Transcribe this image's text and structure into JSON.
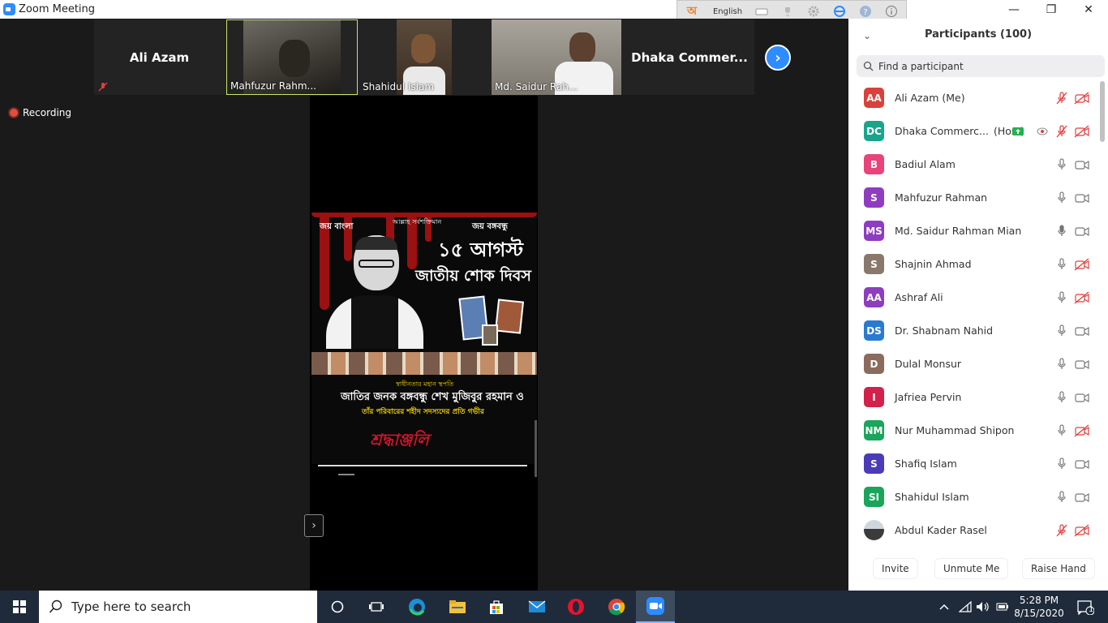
{
  "window": {
    "title": "Zoom Meeting",
    "min_label": "—",
    "max_label": "❐",
    "close_label": "✕"
  },
  "ime": {
    "language": "English",
    "glyph": "অ"
  },
  "thumbnails": [
    {
      "name": "Ali Azam",
      "kind": "name-only",
      "muted": true
    },
    {
      "name": "Mahfuzur Rahm...",
      "kind": "video",
      "muted": false
    },
    {
      "name": "Shahidul Islam",
      "kind": "video",
      "muted": false
    },
    {
      "name": "Md. Saidur Rah...",
      "kind": "video",
      "muted": true
    },
    {
      "name": "Dhaka  Commer...",
      "kind": "name-only",
      "muted": false
    }
  ],
  "next_arrow": "›",
  "recording": {
    "label": "Recording"
  },
  "poster": {
    "top_left": "জয় বাংলা",
    "top_center": "আল্লাহ সর্বশক্তিমান",
    "top_right": "জয় বঙ্গবন্ধু",
    "date": "১৫ আগস্ট",
    "headline": "জাতীয় শোক দিবস",
    "sub1": "স্বাধীনতার মহান স্থপতি",
    "sub2": "জাতির জনক বঙ্গবন্ধু শেখ মুজিবুর রহমান ও",
    "sub3": "তাঁর পরিবারের শহীদ সদস্যদের প্রতি গভীর",
    "sign": "শ্রদ্ধাঞ্জলি"
  },
  "panel": {
    "title": "Participants (100)",
    "search_placeholder": "Find a participant",
    "participants": [
      {
        "initials": "AA",
        "color": "#d9413a",
        "name": "Ali Azam (Me)",
        "host": "",
        "mic": "muted",
        "cam": "off"
      },
      {
        "initials": "DC",
        "color": "#1aa58b",
        "name": "Dhaka Commerc...",
        "host": "(Host)",
        "mic": "muted",
        "cam": "off"
      },
      {
        "initials": "B",
        "color": "#e8437a",
        "name": "Badiul Alam",
        "host": "",
        "mic": "on",
        "cam": "on"
      },
      {
        "initials": "S",
        "color": "#8e3cc0",
        "name": "Mahfuzur Rahman",
        "host": "",
        "mic": "on",
        "cam": "on"
      },
      {
        "initials": "MS",
        "color": "#8e3cc0",
        "name": "Md. Saidur Rahman Mian",
        "host": "",
        "mic": "speaking",
        "cam": "on"
      },
      {
        "initials": "S",
        "color": "#8b786d",
        "name": "Shajnin Ahmad",
        "host": "",
        "mic": "on",
        "cam": "off"
      },
      {
        "initials": "AA",
        "color": "#8e3cc0",
        "name": "Ashraf Ali",
        "host": "",
        "mic": "on",
        "cam": "off"
      },
      {
        "initials": "DS",
        "color": "#2a7ad0",
        "name": "Dr. Shabnam Nahid",
        "host": "",
        "mic": "on",
        "cam": "on"
      },
      {
        "initials": "D",
        "color": "#8b6b5e",
        "name": "Dulal Monsur",
        "host": "",
        "mic": "on",
        "cam": "on"
      },
      {
        "initials": "I",
        "color": "#d2214a",
        "name": "Jafriea Pervin",
        "host": "",
        "mic": "on",
        "cam": "on"
      },
      {
        "initials": "NM",
        "color": "#1aa55b",
        "name": "Nur Muhammad Shipon",
        "host": "",
        "mic": "on",
        "cam": "off"
      },
      {
        "initials": "S",
        "color": "#4a3cb8",
        "name": "Shafiq Islam",
        "host": "",
        "mic": "on",
        "cam": "on"
      },
      {
        "initials": "SI",
        "color": "#1aa55b",
        "name": "Shahidul Islam",
        "host": "",
        "mic": "on",
        "cam": "on"
      },
      {
        "initials": "",
        "color": "#ffffff",
        "name": "Abdul Kader Rasel",
        "host": "",
        "mic": "muted",
        "cam": "off",
        "photo": true
      }
    ],
    "footer": {
      "invite": "Invite",
      "unmute": "Unmute Me",
      "raise": "Raise Hand"
    }
  },
  "taskbar": {
    "search_placeholder": "Type here to search",
    "time": "5:28 PM",
    "date": "8/15/2020",
    "notifications": "1"
  }
}
